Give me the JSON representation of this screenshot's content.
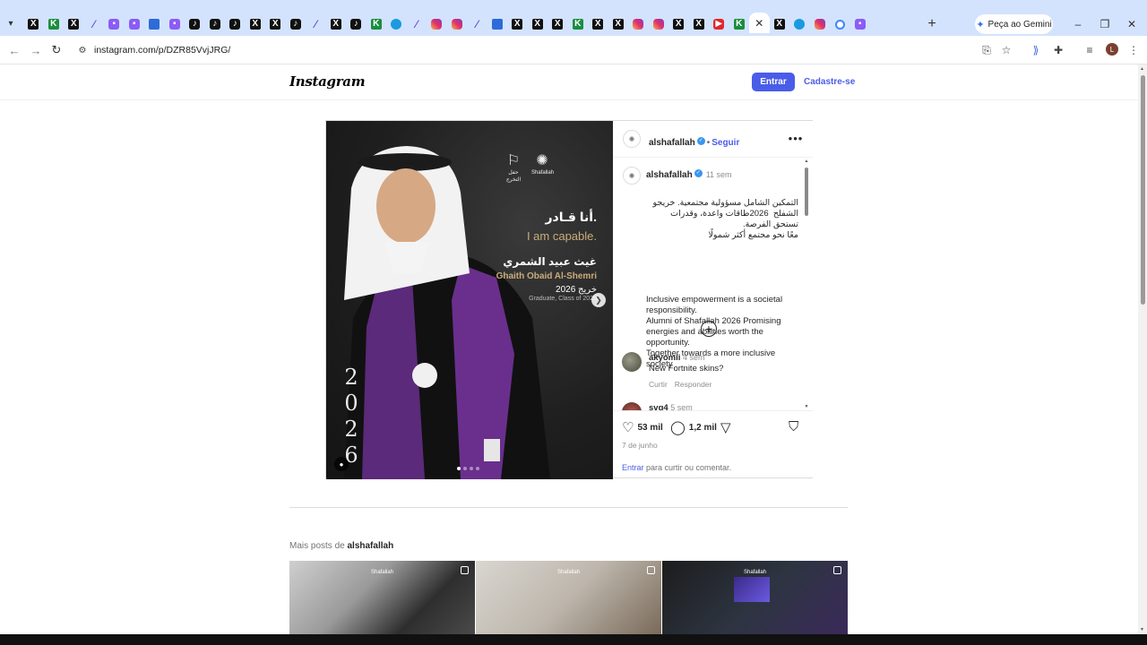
{
  "browser": {
    "tabs": [
      "x",
      "k",
      "x",
      "feather",
      "twitch",
      "twitch",
      "blue",
      "twitch",
      "tiktok",
      "tiktok",
      "tiktok",
      "x",
      "x",
      "tiktok",
      "feather",
      "x",
      "tiktok",
      "k",
      "circ",
      "feather",
      "insta",
      "insta",
      "feather",
      "blue",
      "x",
      "x",
      "x",
      "k",
      "x",
      "x",
      "insta",
      "insta",
      "x",
      "x",
      "yt",
      "k",
      "active",
      "x",
      "circ",
      "insta",
      "g",
      "twitch"
    ],
    "active_tab_icon": "close-icon",
    "new_tab": "+",
    "gemini_label": "Peça ao Gemini",
    "url": "instagram.com/p/DZR85VvjJRG/",
    "profile_initial": "L"
  },
  "header": {
    "logo": "Instagram",
    "login_button": "Entrar",
    "signup_link": "Cadastre-se"
  },
  "post": {
    "username": "alshafallah",
    "follow_label": "Seguir",
    "image": {
      "logo_left": "حفل التخرج",
      "logo_right": "Shafallah",
      "line_ar1": "أنا قـادر.",
      "line_en1": "I am capable.",
      "line_ar2": "غيث عبيد الشمري",
      "line_en2": "Ghaith Obaid Al-Shemri",
      "line_ar3": "خريج 2026",
      "line_en3": "Graduate, Class of 2026",
      "year_digits": [
        "2",
        "0",
        "2",
        "6"
      ],
      "slides_count": 4,
      "current_slide": 1
    },
    "caption_time": "11 sem",
    "caption_ar": "التمكين الشامل مسؤولية مجتمعية. خريجو الشفلح  2026طاقات واعدة، وقدرات تستحق الفرصة.\nمعًا نحو مجتمع أكثر شمولًا",
    "caption_en": "Inclusive empowerment is a societal responsibility.\nAlumni of Shafallah 2026 Promising energies and abilities worth the opportunity.\nTogether towards a more inclusive society",
    "comments": [
      {
        "user": "akyomii",
        "time": "4 sem",
        "text": "New Fortnite skins?",
        "like": "Curtir",
        "reply": "Responder"
      },
      {
        "user": "svg4",
        "time": "5 sem",
        "text": "",
        "like": "",
        "reply": ""
      }
    ],
    "likes": "53 mil",
    "comments_count": "1,2 mil",
    "date": "7 de junho",
    "login_prompt_link": "Entrar",
    "login_prompt_rest": " para curtir ou comentar."
  },
  "more_posts": {
    "prefix": "Mais posts de ",
    "username": "alshafallah",
    "thumb_logo": "Shafallah"
  }
}
